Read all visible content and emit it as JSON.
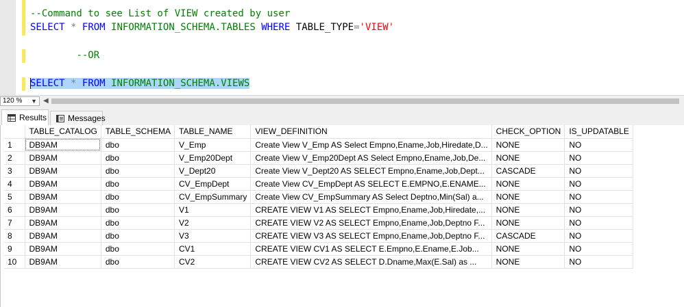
{
  "editor": {
    "line1_comment": "--Command to see List of VIEW created by user",
    "line2": {
      "kw_select": "SELECT",
      "star": "*",
      "kw_from": "FROM",
      "object": "INFORMATION_SCHEMA.TABLES",
      "kw_where": "WHERE",
      "column": "TABLE_TYPE",
      "eq": "=",
      "string": "'VIEW'"
    },
    "line3_comment": "--OR",
    "line4": {
      "kw_select": "SELECT",
      "star": "*",
      "kw_from": "FROM",
      "object": "INFORMATION_SCHEMA.VIEWS"
    }
  },
  "toolbar": {
    "zoom_value": "120 %"
  },
  "tabs": [
    {
      "label": "Results",
      "icon": "grid-icon"
    },
    {
      "label": "Messages",
      "icon": "messages-icon"
    }
  ],
  "grid": {
    "columns": [
      "",
      "TABLE_CATALOG",
      "TABLE_SCHEMA",
      "TABLE_NAME",
      "VIEW_DEFINITION",
      "CHECK_OPTION",
      "IS_UPDATABLE"
    ],
    "rows": [
      [
        "1",
        "DB9AM",
        "dbo",
        "V_Emp",
        "Create View V_Emp AS Select Empno,Ename,Job,Hiredate,D...",
        "NONE",
        "NO"
      ],
      [
        "2",
        "DB9AM",
        "dbo",
        "V_Emp20Dept",
        "Create View V_Emp20Dept AS Select Empno,Ename,Job,De...",
        "NONE",
        "NO"
      ],
      [
        "3",
        "DB9AM",
        "dbo",
        "V_Dept20",
        "Create View V_Dept20 AS SELECT Empno,Ename,Job,Dept...",
        "CASCADE",
        "NO"
      ],
      [
        "4",
        "DB9AM",
        "dbo",
        "CV_EmpDept",
        "Create View CV_EmpDept AS SELECT E.EMPNO,E.ENAME...",
        "NONE",
        "NO"
      ],
      [
        "5",
        "DB9AM",
        "dbo",
        "CV_EmpSummary",
        "Create View CV_EmpSummary AS   Select Deptno,Min(Sal) a...",
        "NONE",
        "NO"
      ],
      [
        "6",
        "DB9AM",
        "dbo",
        "V1",
        "CREATE VIEW V1 AS SELECT Empno,Ename,Job,Hiredate,...",
        "NONE",
        "NO"
      ],
      [
        "7",
        "DB9AM",
        "dbo",
        "V2",
        "CREATE VIEW V2 AS SELECT Empno,Ename,Job,Deptno F...",
        "NONE",
        "NO"
      ],
      [
        "8",
        "DB9AM",
        "dbo",
        "V3",
        "CREATE VIEW V3 AS SELECT Empno,Ename,Job,Deptno F...",
        "CASCADE",
        "NO"
      ],
      [
        "9",
        "DB9AM",
        "dbo",
        "CV1",
        "CREATE VIEW CV1   AS  SELECT E.Empno,E.Ename,E.Job...",
        "NONE",
        "NO"
      ],
      [
        "10",
        "DB9AM",
        "dbo",
        "CV2",
        "CREATE VIEW CV2   AS  SELECT D.Dname,Max(E.Sal) as ...",
        "NONE",
        "NO"
      ]
    ]
  }
}
